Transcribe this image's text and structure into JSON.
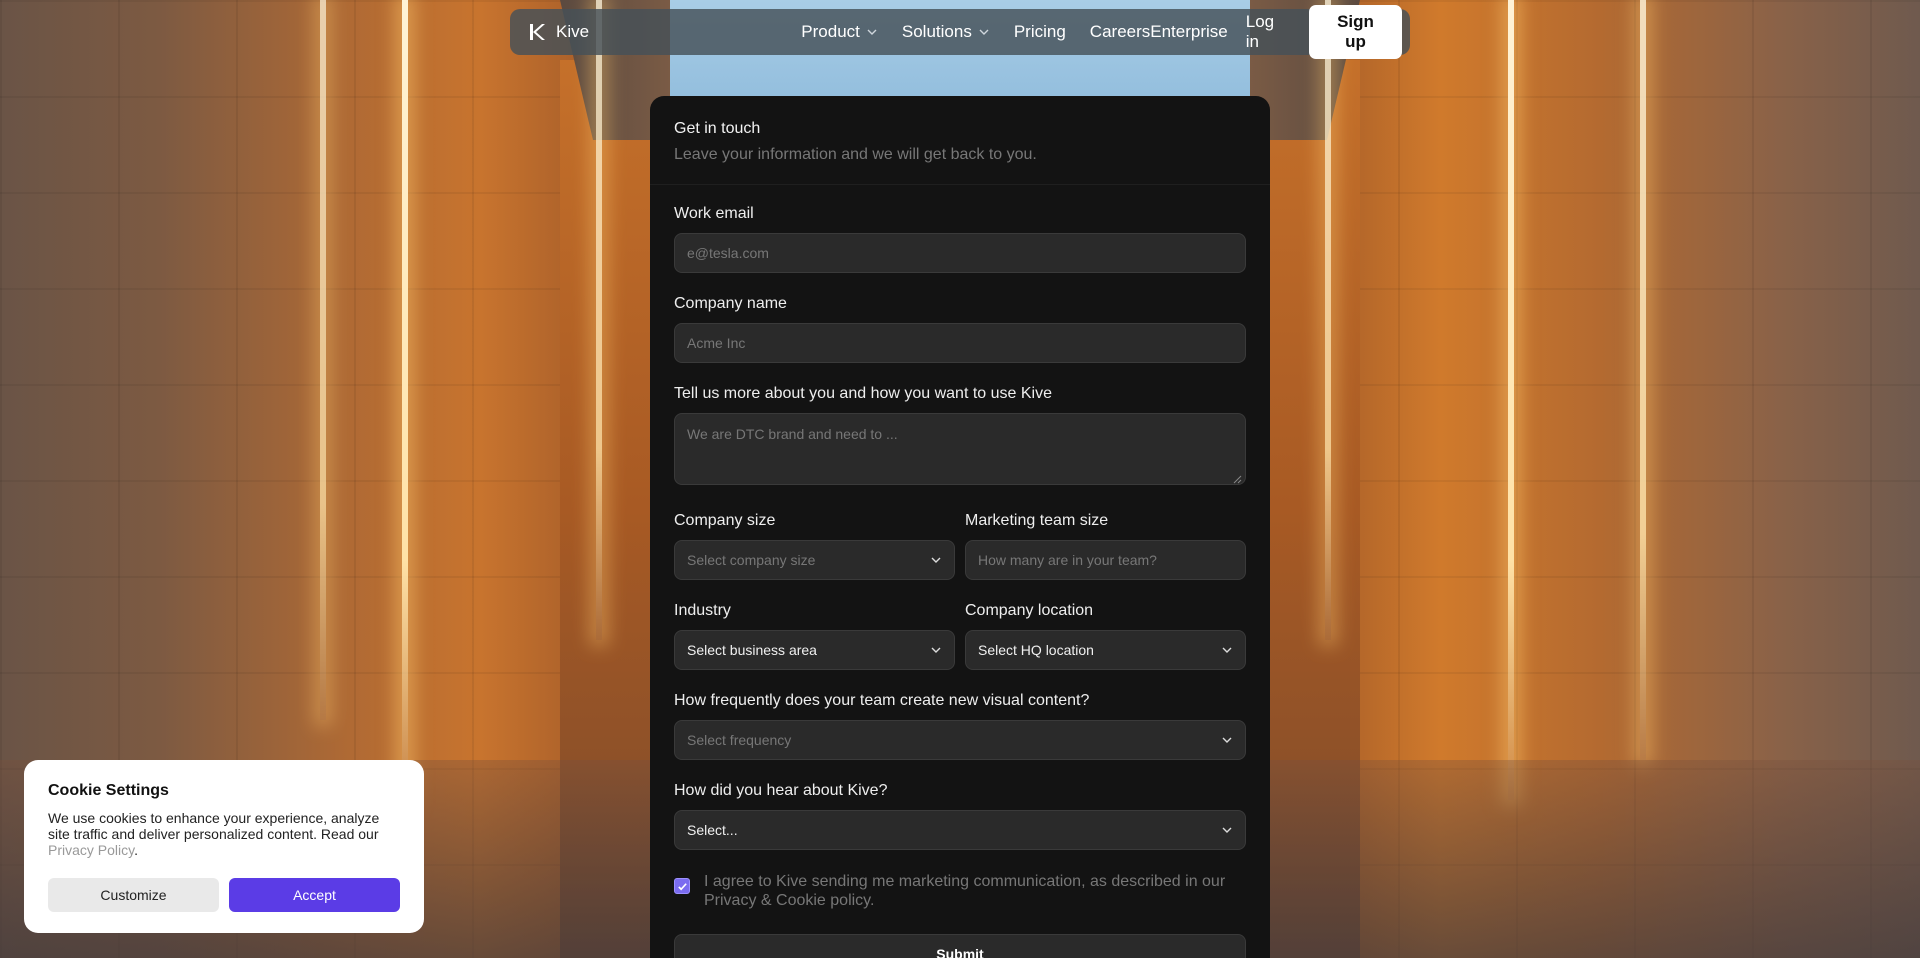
{
  "colors": {
    "accent": "#5b3ce6",
    "checkbox": "#7b6cf0",
    "card_bg": "#131313",
    "field_bg": "#2a2a2a"
  },
  "navbar": {
    "brand_name": "Kive",
    "brand_icon": "kive-logo-icon",
    "items": [
      {
        "label": "Product",
        "has_dropdown": true
      },
      {
        "label": "Solutions",
        "has_dropdown": true
      },
      {
        "label": "Pricing",
        "has_dropdown": false
      },
      {
        "label": "Careers",
        "has_dropdown": false
      }
    ],
    "enterprise": "Enterprise",
    "login": "Log in",
    "signup": "Sign up"
  },
  "form": {
    "title": "Get in touch",
    "subtitle": "Leave your information and we will get back to you.",
    "work_email": {
      "label": "Work email",
      "placeholder": "e@tesla.com"
    },
    "company_name": {
      "label": "Company name",
      "placeholder": "Acme Inc"
    },
    "about": {
      "label": "Tell us more about you and how you want to use Kive",
      "placeholder": "We are DTC brand and need to ..."
    },
    "company_size": {
      "label": "Company size",
      "placeholder": "Select company size"
    },
    "marketing_team_size": {
      "label": "Marketing team size",
      "placeholder": "How many are in your team?"
    },
    "industry": {
      "label": "Industry",
      "value": "Select business area"
    },
    "company_location": {
      "label": "Company location",
      "value": "Select HQ location"
    },
    "frequency": {
      "label": "How frequently does your team create new visual content?",
      "placeholder": "Select frequency"
    },
    "source": {
      "label": "How did you hear about Kive?",
      "value": "Select..."
    },
    "consent": {
      "checked": true,
      "text": "I agree to Kive sending me marketing communication, as described in our Privacy & Cookie policy."
    },
    "submit": "Submit"
  },
  "cookie": {
    "title": "Cookie Settings",
    "body": "We use cookies to enhance your experience, analyze site traffic and deliver personalized content. Read our ",
    "link": "Privacy Policy",
    "period": ".",
    "customize": "Customize",
    "accept": "Accept"
  }
}
